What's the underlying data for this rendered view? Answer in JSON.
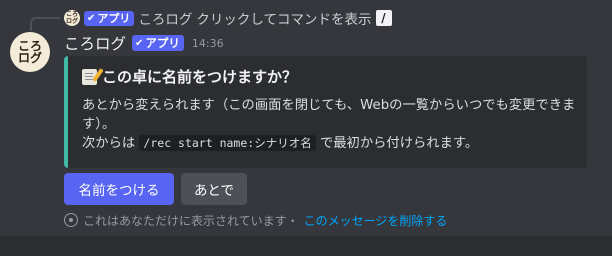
{
  "reply": {
    "avatar_text_line1": "ころ",
    "avatar_text_line2": "ログ",
    "app_badge": "アプリ",
    "author": "ころログ",
    "command_text": "クリックしてコマンドを表示",
    "command_icon_glyph": "/"
  },
  "message": {
    "avatar_line1": "ころ",
    "avatar_line2": "ログ",
    "author": "ころログ",
    "app_badge": "アプリ",
    "timestamp": "14:36",
    "check_glyph": "✔"
  },
  "embed": {
    "accent_color": "#3fb8a6",
    "title": "この卓に名前をつけますか？",
    "title_icon": "memo-icon",
    "desc_line1": "あとから変えられます（この画面を閉じても、Webの一覧からいつでも変更できます）。",
    "desc_line2_prefix": "次からは",
    "desc_code": "/rec start name:シナリオ名",
    "desc_line2_suffix": "で最初から付けられます。"
  },
  "buttons": {
    "primary_label": "名前をつける",
    "secondary_label": "あとで"
  },
  "ephemeral": {
    "notice": "これはあなただけに表示されています・",
    "dismiss_label": "このメッセージを削除する"
  },
  "colors": {
    "background": "#313338",
    "brand": "#5865f2",
    "link": "#00a8fc"
  }
}
